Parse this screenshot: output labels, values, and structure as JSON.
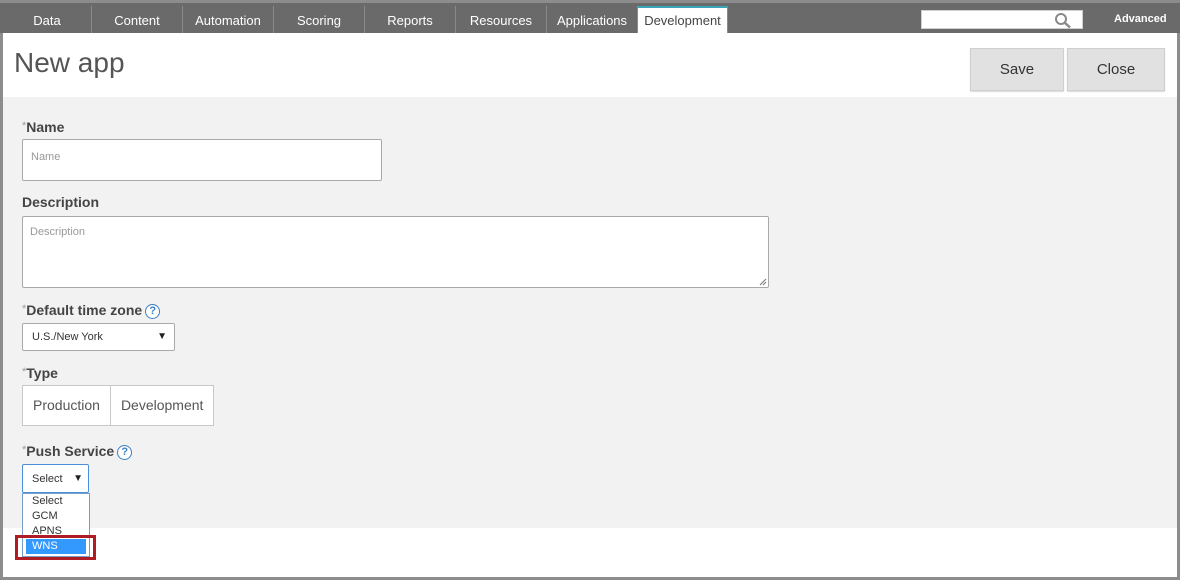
{
  "nav": {
    "tabs": [
      {
        "label": "Data"
      },
      {
        "label": "Content"
      },
      {
        "label": "Automation"
      },
      {
        "label": "Scoring"
      },
      {
        "label": "Reports"
      },
      {
        "label": "Resources"
      },
      {
        "label": "Applications"
      },
      {
        "label": "Development",
        "active": true
      }
    ],
    "search_value": "",
    "advanced_label": "Advanced"
  },
  "header": {
    "title": "New app",
    "save_label": "Save",
    "close_label": "Close"
  },
  "form": {
    "name": {
      "required_mark": "*",
      "label": "Name",
      "placeholder": "Name",
      "value": ""
    },
    "description": {
      "label": "Description",
      "placeholder": "Description",
      "value": ""
    },
    "timezone": {
      "required_mark": "*",
      "label": "Default time zone",
      "help": "?",
      "selected": "U.S./New York"
    },
    "type": {
      "required_mark": "*",
      "label": "Type",
      "options": [
        "Production",
        "Development"
      ]
    },
    "push_service": {
      "required_mark": "*",
      "label": "Push Service",
      "help": "?",
      "selected": "Select",
      "options": [
        "Select",
        "GCM",
        "APNS",
        "WNS"
      ],
      "highlighted_option": "WNS"
    }
  },
  "colors": {
    "nav_bg": "#6a6a6a",
    "active_tab_accent": "#3aa5b8",
    "form_bg": "#f2f2f2",
    "option_highlight": "#3399ff",
    "callout_border": "#b01c24",
    "help_icon": "#3a7fc4"
  },
  "icons": {
    "search": "magnifier-icon",
    "help": "question-circle-icon",
    "dropdown": "triangle-down-icon"
  }
}
